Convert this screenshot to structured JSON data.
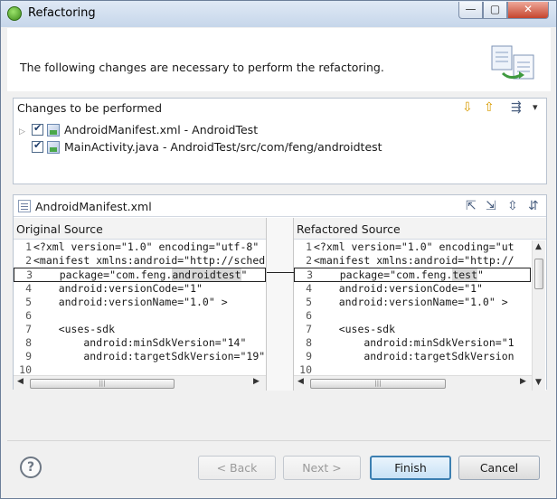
{
  "window": {
    "title": "Refactoring",
    "min_glyph": "—",
    "max_glyph": "▢",
    "close_glyph": "✕"
  },
  "header": {
    "message": "The following changes are necessary to perform the refactoring."
  },
  "changes": {
    "title": "Changes to be performed",
    "items": [
      {
        "label": "AndroidManifest.xml - AndroidTest",
        "checked": true,
        "expander": "▷"
      },
      {
        "label": "MainActivity.java - AndroidTest/src/com/feng/androidtest",
        "checked": true,
        "expander": ""
      }
    ],
    "toolbar": {
      "next_glyph": "⇩",
      "prev_glyph": "⇧",
      "filter_glyph": "⇶",
      "menu_glyph": "▾"
    }
  },
  "compare": {
    "title": "AndroidManifest.xml",
    "toolbar_glyphs": [
      "⇱",
      "⇲",
      "⇳",
      "⇵"
    ],
    "original": {
      "label": "Original Source",
      "lines": [
        {
          "n": "1",
          "text": "<?xml version=\"1.0\" encoding=\"utf-8\""
        },
        {
          "n": "2",
          "text": "<manifest xmlns:android=\"http://sched"
        },
        {
          "n": "3",
          "pre": "    package=\"com.feng.",
          "hl": "androidtest",
          "post": "\""
        },
        {
          "n": "4",
          "text": "    android:versionCode=\"1\""
        },
        {
          "n": "5",
          "text": "    android:versionName=\"1.0\" >"
        },
        {
          "n": "6",
          "text": ""
        },
        {
          "n": "7",
          "text": "    <uses-sdk"
        },
        {
          "n": "8",
          "text": "        android:minSdkVersion=\"14\""
        },
        {
          "n": "9",
          "text": "        android:targetSdkVersion=\"19\""
        },
        {
          "n": "10",
          "text": ""
        }
      ]
    },
    "refactored": {
      "label": "Refactored Source",
      "lines": [
        {
          "n": "1",
          "text": "<?xml version=\"1.0\" encoding=\"ut"
        },
        {
          "n": "2",
          "text": "<manifest xmlns:android=\"http://"
        },
        {
          "n": "3",
          "pre": "    package=\"com.feng.",
          "hl": "test",
          "post": "\""
        },
        {
          "n": "4",
          "text": "    android:versionCode=\"1\""
        },
        {
          "n": "5",
          "text": "    android:versionName=\"1.0\" >"
        },
        {
          "n": "6",
          "text": ""
        },
        {
          "n": "7",
          "text": "    <uses-sdk"
        },
        {
          "n": "8",
          "text": "        android:minSdkVersion=\"1"
        },
        {
          "n": "9",
          "text": "        android:targetSdkVersion"
        },
        {
          "n": "10",
          "text": ""
        }
      ]
    },
    "scroll": {
      "left_glyph": "◀",
      "right_glyph": "▶",
      "up_glyph": "▲",
      "down_glyph": "▼",
      "thumb_grip": "|||"
    }
  },
  "buttons": {
    "help": "?",
    "back": "< Back",
    "next": "Next >",
    "finish": "Finish",
    "cancel": "Cancel"
  }
}
